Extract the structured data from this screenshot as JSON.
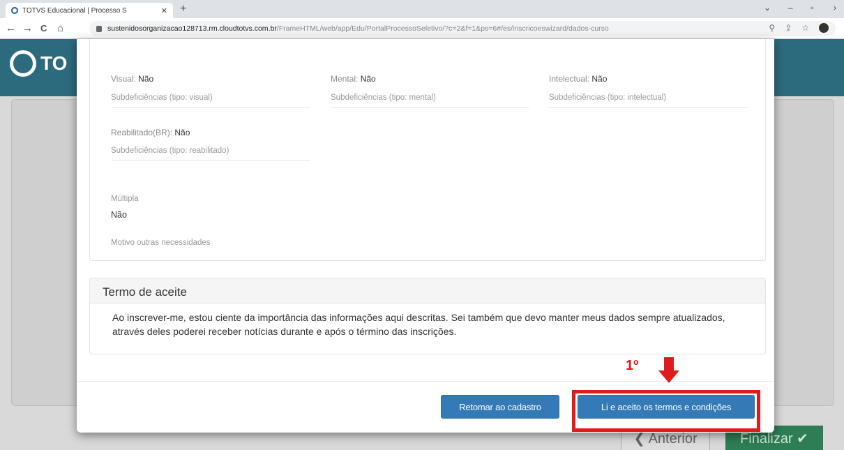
{
  "browser": {
    "tab_title": "TOTVS Educacional | Processo S",
    "tab_close": "✕",
    "new_tab": "+",
    "url_host": "sustenidosorganizacao128713.rm.cloudtotvs.com.br",
    "url_path": "/FrameHTML/web/app/Edu/PortalProcessoSeletivo/?c=2&f=1&ps=6#/es/inscricoeswizard/dados-curso",
    "back": "←",
    "forward": "→",
    "reload": "C",
    "home": "⌂"
  },
  "app": {
    "logo_text": "TO",
    "btn_anterior": "❮ Anterior",
    "btn_finalizar": "Finalizar ✔"
  },
  "deficiencias": {
    "visual_label": "Visual:",
    "visual_value": "Não",
    "visual_sub": "Subdeficiências (tipo: visual)",
    "mental_label": "Mental:",
    "mental_value": "Não",
    "mental_sub": "Subdeficiências (tipo: mental)",
    "intelectual_label": "Intelectual:",
    "intelectual_value": "Não",
    "intelectual_sub": "Subdeficiências (tipo: intelectual)",
    "reabilitado_label": "Reabilitado(BR):",
    "reabilitado_value": "Não",
    "reabilitado_sub": "Subdeficiências (tipo: reabilitado)",
    "multipla_label": "Múltipla",
    "multipla_value": "Não",
    "motivo_label": "Motivo outras necessidades"
  },
  "termo": {
    "title": "Termo de aceite",
    "text": "Ao inscrever-me, estou ciente da importância das informações aqui descritas. Sei também que devo manter meus dados sempre atualizados, através deles poderei receber notícias durante e após o término das inscrições."
  },
  "actions": {
    "retornar": "Retomar ao cadastro",
    "aceito": "Li e aceito os termos e condições"
  },
  "annotation": {
    "step": "1º",
    "color": "#e01b1b"
  }
}
